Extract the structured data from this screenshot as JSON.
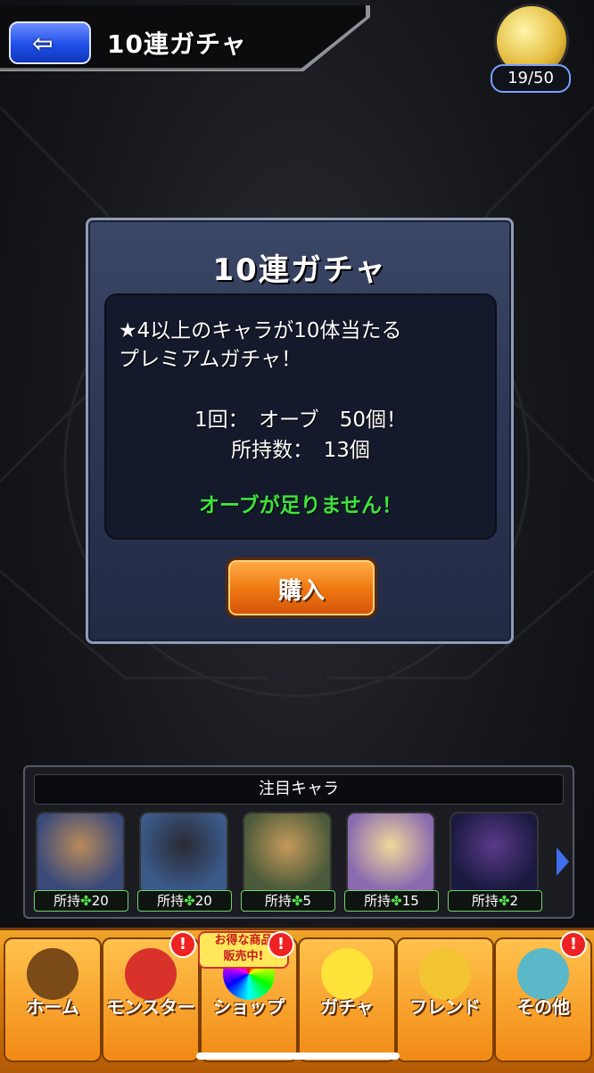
{
  "header": {
    "back_icon": "back-arrow-icon",
    "title": "10連ガチャ"
  },
  "stamina": {
    "icon": "star-orb-icon",
    "value": "19/50"
  },
  "dialog": {
    "title": "10連ガチャ",
    "description_line1": "★4以上のキャラが10体当たる",
    "description_line2": "プレミアムガチャ！",
    "cost": "1回：　オーブ　50個！",
    "owned": "所持数：　13個",
    "warning": "オーブが足りません！",
    "warning_color": "#3fe23c",
    "buy_label": "購入"
  },
  "featured": {
    "heading": "注目キャラ",
    "characters": [
      {
        "owned_label": "所持",
        "owned_count": "20"
      },
      {
        "owned_label": "所持",
        "owned_count": "20"
      },
      {
        "owned_label": "所持",
        "owned_count": "5"
      },
      {
        "owned_label": "所持",
        "owned_count": "15"
      },
      {
        "owned_label": "所持",
        "owned_count": "2"
      }
    ]
  },
  "nav": {
    "items": [
      {
        "label": "ホーム",
        "icon": "home-icon"
      },
      {
        "label": "モンスター",
        "icon": "monster-icon",
        "alert": "!"
      },
      {
        "label": "ショップ",
        "icon": "shop-icon",
        "alert": "!"
      },
      {
        "label": "ガチャ",
        "icon": "gacha-icon"
      },
      {
        "label": "フレンド",
        "icon": "friend-icon"
      },
      {
        "label": "その他",
        "icon": "other-icon",
        "alert": "!"
      }
    ],
    "sale_tag_line1": "お得な商品",
    "sale_tag_line2": "販売中!"
  },
  "colors": {
    "accent_blue": "#1f4fe8",
    "button_orange": "#f07a12",
    "nav_orange": "#d77b0c"
  }
}
